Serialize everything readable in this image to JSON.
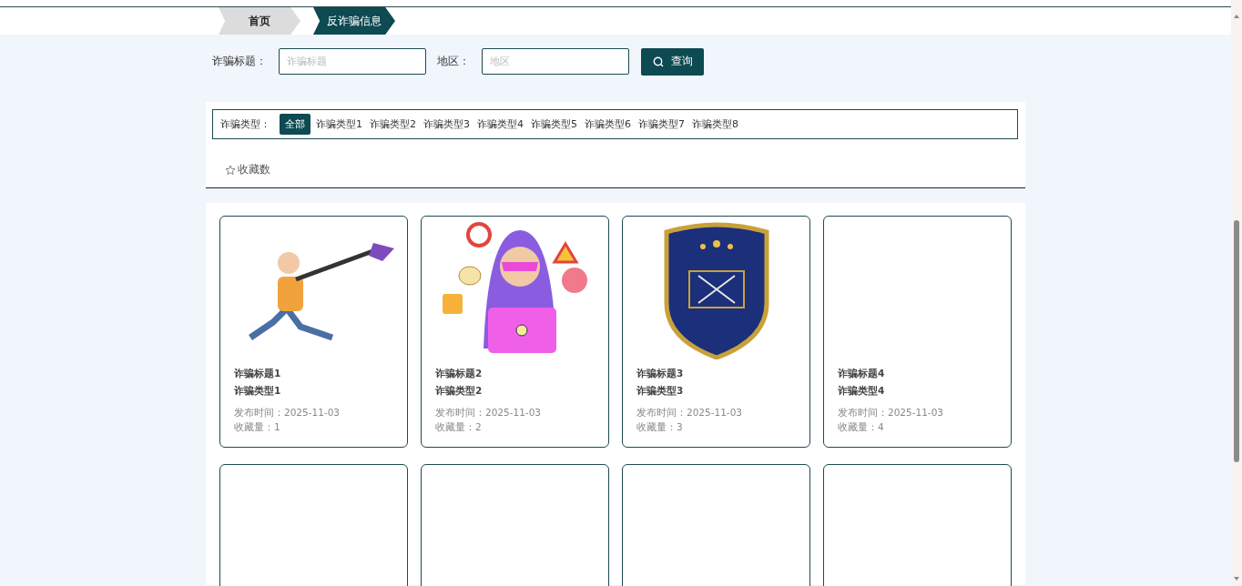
{
  "breadcrumb": [
    {
      "label": "首页",
      "selected": false
    },
    {
      "label": "反诈骗信息",
      "selected": true
    }
  ],
  "search": {
    "fields": [
      {
        "label": "诈骗标题：",
        "placeholder": "诈骗标题"
      },
      {
        "label": "地区：",
        "placeholder": "地区"
      }
    ],
    "button": "查询"
  },
  "filter": {
    "label": "诈骗类型：",
    "options": [
      {
        "label": "全部",
        "selected": true
      },
      {
        "label": "诈骗类型1",
        "selected": false
      },
      {
        "label": "诈骗类型2",
        "selected": false
      },
      {
        "label": "诈骗类型3",
        "selected": false
      },
      {
        "label": "诈骗类型4",
        "selected": false
      },
      {
        "label": "诈骗类型5",
        "selected": false
      },
      {
        "label": "诈骗类型6",
        "selected": false
      },
      {
        "label": "诈骗类型7",
        "selected": false
      },
      {
        "label": "诈骗类型8",
        "selected": false
      }
    ]
  },
  "sort": {
    "label": "收藏数"
  },
  "cards": [
    {
      "kind": "runner",
      "title": "诈骗标题1",
      "type": "诈骗类型1",
      "date": "发布时间：2025-11-03",
      "count": "收藏量：1"
    },
    {
      "kind": "hacker",
      "title": "诈骗标题2",
      "type": "诈骗类型2",
      "date": "发布时间：2025-11-03",
      "count": "收藏量：2"
    },
    {
      "kind": "badge",
      "title": "诈骗标题3",
      "type": "诈骗类型3",
      "date": "发布时间：2025-11-03",
      "count": "收藏量：3"
    },
    {
      "kind": "blank",
      "title": "诈骗标题4",
      "type": "诈骗类型4",
      "date": "发布时间：2025-11-03",
      "count": "收藏量：4"
    },
    {
      "kind": "blank"
    },
    {
      "kind": "blank"
    },
    {
      "kind": "blank"
    },
    {
      "kind": "blank"
    }
  ]
}
